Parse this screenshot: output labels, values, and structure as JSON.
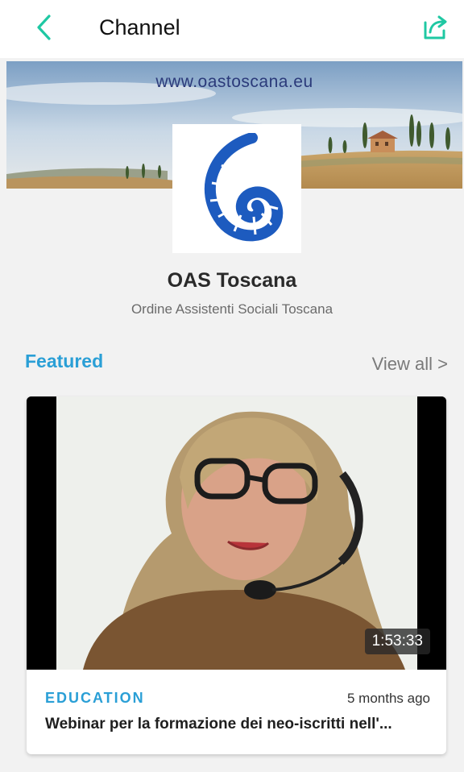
{
  "header": {
    "title": "Channel",
    "back_icon": "chevron-left-icon",
    "share_icon": "share-icon",
    "accent_color": "#1fc8a3"
  },
  "banner": {
    "url_text": "www.oastoscana.eu"
  },
  "channel": {
    "name": "OAS Toscana",
    "subtitle": "Ordine Assistenti Sociali Toscana",
    "logo_icon": "nautilus-shell-logo",
    "logo_color": "#1d5bbf"
  },
  "featured": {
    "label": "Featured",
    "view_all": "View all >",
    "label_color": "#2a9fd6"
  },
  "video": {
    "duration": "1:53:33",
    "category": "EDUCATION",
    "age": "5 months ago",
    "title": "Webinar per la formazione dei neo-iscritti nell'..."
  }
}
